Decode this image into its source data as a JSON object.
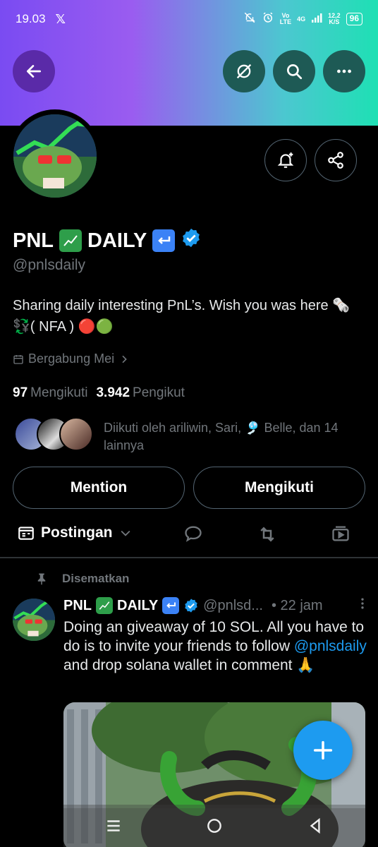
{
  "status_bar": {
    "time": "19.03",
    "x_logo": "𝕏",
    "network_top": "Vo",
    "network_bottom": "LTE",
    "signal_label": "4G",
    "speed_top": "12,2",
    "speed_bottom": "K/S",
    "battery": "96"
  },
  "colors": {
    "accent": "#1d9bf0",
    "banner_left": "#7a4bf2",
    "banner_right": "#1ee0b4",
    "muted": "#71767b"
  },
  "profile": {
    "name": "PNL",
    "name_suffix": "DAILY",
    "handle": "@pnlsdaily",
    "bio": "Sharing daily interesting PnL’s. Wish you was here 🗞️ 💱( NFA ) 🔴🟢",
    "joined": "Bergabung Mei",
    "following_count": "97",
    "following_label": "Mengikuti",
    "followers_count": "3.942",
    "followers_label": "Pengikut",
    "followed_by": "Diikuti oleh ariliwin, Sari, 🎐 Belle, dan 14 lainnya"
  },
  "buttons": {
    "mention": "Mention",
    "following": "Mengikuti"
  },
  "tabs": {
    "posts": "Postingan"
  },
  "pinned_post": {
    "pinned_label": "Disematkan",
    "name": "PNL",
    "name_suffix": "DAILY",
    "handle": "@pnlsd...",
    "time": "• 22 jam",
    "text_before": "Doing an giveaway of 10 SOL. All you have to do is to invite your friends to follow ",
    "mention": "@pnlsdaily",
    "text_after": "  and drop solana wallet in comment 🙏"
  }
}
